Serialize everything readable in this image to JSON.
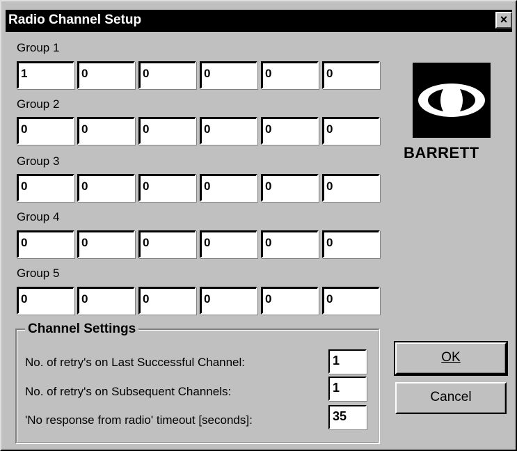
{
  "window": {
    "title": "Radio Channel Setup",
    "close_label": "×"
  },
  "groups": [
    {
      "label": "Group 1",
      "values": [
        "1",
        "0",
        "0",
        "0",
        "0",
        "0"
      ]
    },
    {
      "label": "Group 2",
      "values": [
        "0",
        "0",
        "0",
        "0",
        "0",
        "0"
      ]
    },
    {
      "label": "Group 3",
      "values": [
        "0",
        "0",
        "0",
        "0",
        "0",
        "0"
      ]
    },
    {
      "label": "Group 4",
      "values": [
        "0",
        "0",
        "0",
        "0",
        "0",
        "0"
      ]
    },
    {
      "label": "Group 5",
      "values": [
        "0",
        "0",
        "0",
        "0",
        "0",
        "0"
      ]
    }
  ],
  "logo": {
    "brand": "BARRETT"
  },
  "channel_settings": {
    "title": "Channel Settings",
    "items": [
      {
        "label": "No. of retry's on Last Successful Channel:",
        "value": "1"
      },
      {
        "label": "No. of retry's on Subsequent Channels:",
        "value": "1"
      },
      {
        "label": "'No response from radio' timeout [seconds]:",
        "value": "35"
      }
    ]
  },
  "buttons": {
    "ok": "OK",
    "cancel": "Cancel"
  }
}
